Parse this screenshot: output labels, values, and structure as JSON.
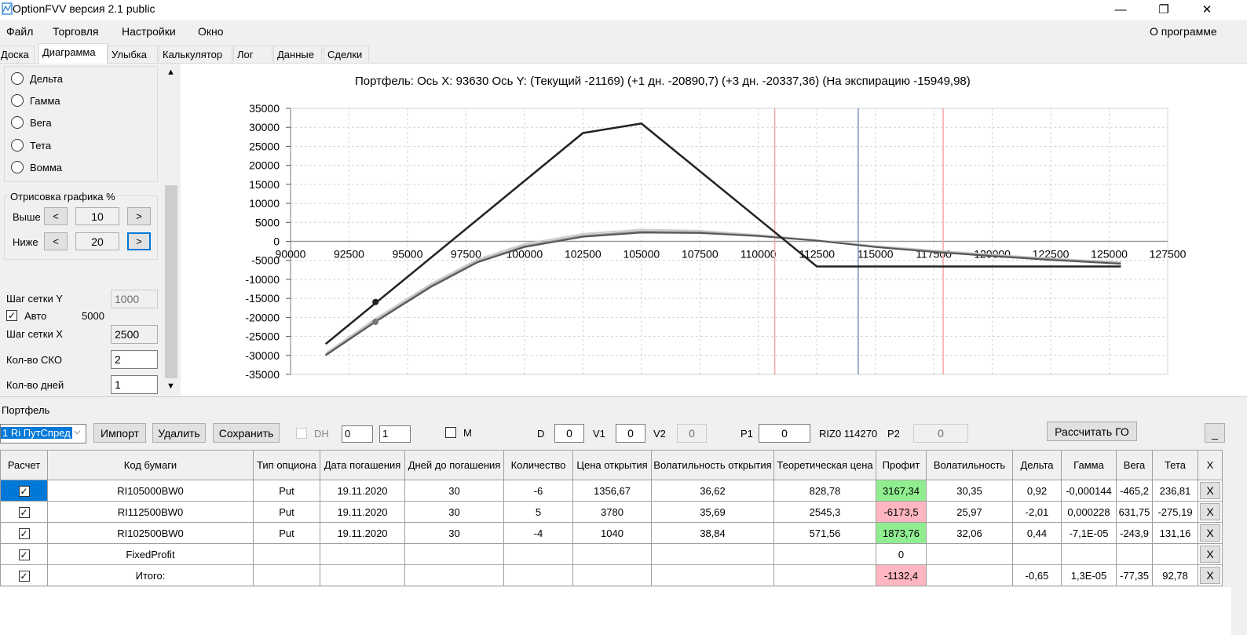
{
  "window": {
    "title": "OptionFVV версия 2.1 public",
    "minimize": "—",
    "maximize": "❐",
    "close": "✕"
  },
  "menu": {
    "items": [
      "Файл",
      "Торговля",
      "Настройки",
      "Окно"
    ],
    "about": "О программе"
  },
  "tabs": [
    "Доска",
    "Диаграмма",
    "Улыбка",
    "Калькулятор",
    "Лог",
    "Данные",
    "Сделки"
  ],
  "active_tab": "Диаграмма",
  "left_panel": {
    "radios": [
      "Дельта",
      "Гамма",
      "Вега",
      "Тета",
      "Вомма"
    ],
    "draw_group_title": "Отрисовка графика %",
    "above_label": "Выше",
    "above_value": "10",
    "below_label": "Ниже",
    "below_value": "20",
    "prev": "<",
    "next": ">",
    "grid_y_label": "Шаг сетки Y",
    "grid_y_value": "1000",
    "auto_label": "Авто",
    "auto_value": "5000",
    "grid_x_label": "Шаг сетки X",
    "grid_x_value": "2500",
    "sko_label": "Кол-во СКО",
    "sko_value": "2",
    "days_label": "Кол-во дней",
    "days_value": "1"
  },
  "chart_data": {
    "type": "line",
    "title": "Портфель: Ось X: 93630 Ось Y:  (Текущий -21169)  (+1 дн. -20890,7)  (+3 дн. -20337,36)  (На экспирацию -15949,98)",
    "xlim": [
      90000,
      127500
    ],
    "ylim": [
      -35000,
      35000
    ],
    "x_ticks": [
      90000,
      92500,
      95000,
      97500,
      100000,
      102500,
      105000,
      107500,
      110000,
      112500,
      115000,
      117500,
      120000,
      122500,
      125000,
      127500
    ],
    "y_ticks": [
      35000,
      30000,
      25000,
      20000,
      15000,
      10000,
      5000,
      0,
      -5000,
      -10000,
      -15000,
      -20000,
      -25000,
      -30000,
      -35000
    ],
    "grid": true,
    "series": [
      {
        "color": "#222222",
        "x": [
          91500,
          102500,
          105000,
          112500,
          125500
        ],
        "y": [
          -27000,
          28500,
          31000,
          -6600,
          -6600
        ]
      },
      {
        "color": "#555555",
        "x": [
          91500,
          93630,
          96000,
          98000,
          100000,
          102500,
          105000,
          107500,
          110000,
          112500,
          115000,
          117500,
          120000,
          122500,
          125500
        ],
        "y": [
          -30000,
          -21169,
          -12000,
          -5500,
          -1500,
          1200,
          2300,
          2200,
          1400,
          200,
          -1500,
          -2800,
          -3900,
          -4900,
          -5900
        ]
      },
      {
        "color": "#999999",
        "x": [
          91500,
          93630,
          96000,
          98000,
          100000,
          102500,
          105000,
          107500,
          110000,
          112500,
          115000,
          117500,
          120000,
          122500,
          125500
        ],
        "y": [
          -29800,
          -20891,
          -11700,
          -5200,
          -1200,
          1500,
          2600,
          2400,
          1500,
          200,
          -1400,
          -2600,
          -3700,
          -4700,
          -5700
        ]
      },
      {
        "color": "#cccccc",
        "x": [
          91500,
          93630,
          96000,
          98000,
          100000,
          102500,
          105000,
          107500,
          110000,
          112500,
          115000,
          117500,
          120000,
          122500,
          125500
        ],
        "y": [
          -29500,
          -20337,
          -11200,
          -4700,
          -700,
          2000,
          3100,
          2800,
          1700,
          300,
          -1200,
          -2400,
          -3500,
          -4500,
          -5500
        ]
      }
    ],
    "markers": [
      {
        "x": 93630,
        "y": -15950,
        "color": "#222222"
      },
      {
        "x": 93630,
        "y": -21169,
        "color": "#777777"
      }
    ],
    "vlines": [
      {
        "x": 110700,
        "color": "#f4a6a6"
      },
      {
        "x": 114270,
        "color": "#7a94b8"
      },
      {
        "x": 117900,
        "color": "#f4a6a6"
      }
    ]
  },
  "portfolio": {
    "label": "Портфель",
    "select_value": "1 Ri ПутСпред",
    "import": "Импорт",
    "delete": "Удалить",
    "save": "Сохранить",
    "dh_label": "DH",
    "spin1": "0",
    "spin2": "1",
    "m_label": "M",
    "d_label": "D",
    "d_value": "0",
    "v1_label": "V1",
    "v1_value": "0",
    "v2_label": "V2",
    "v2_value": "0",
    "p1_label": "P1",
    "p1_value": "0",
    "riz_text": "RIZ0 114270",
    "p2_label": "P2",
    "p2_value": "0",
    "calc_go": "Рассчитать ГО",
    "underscore_btn": "_"
  },
  "table": {
    "headers": [
      "Расчет",
      "Код бумаги",
      "Тип опциона",
      "Дата погашения",
      "Дней до погашения",
      "Количество",
      "Цена открытия",
      "Волатильность открытия",
      "Теоретическая цена",
      "Профит",
      "Волатильность",
      "Дельта",
      "Гамма",
      "Вега",
      "Тета",
      "X"
    ],
    "rows": [
      [
        "RI105000BW0",
        "Put",
        "19.11.2020",
        "30",
        "-6",
        "1356,67",
        "36,62",
        "828,78",
        "3167,34",
        "30,35",
        "0,92",
        "-0,000144",
        "-465,2",
        "236,81"
      ],
      [
        "RI112500BW0",
        "Put",
        "19.11.2020",
        "30",
        "5",
        "3780",
        "35,69",
        "2545,3",
        "-6173,5",
        "25,97",
        "-2,01",
        "0,000228",
        "631,75",
        "-275,19"
      ],
      [
        "RI102500BW0",
        "Put",
        "19.11.2020",
        "30",
        "-4",
        "1040",
        "38,84",
        "571,56",
        "1873,76",
        "32,06",
        "0,44",
        "-7,1E-05",
        "-243,9",
        "131,16"
      ],
      [
        "FixedProfit",
        "",
        "",
        "",
        "",
        "",
        "",
        "",
        "0",
        "",
        "",
        "",
        "",
        ""
      ],
      [
        "Итого:",
        "",
        "",
        "",
        "",
        "",
        "",
        "",
        "-1132,4",
        "",
        "-0,65",
        "1,3E-05",
        "-77,35",
        "92,78"
      ]
    ],
    "profit_colors": [
      "green",
      "pink",
      "green",
      "",
      "pink"
    ],
    "x_label": "X"
  }
}
